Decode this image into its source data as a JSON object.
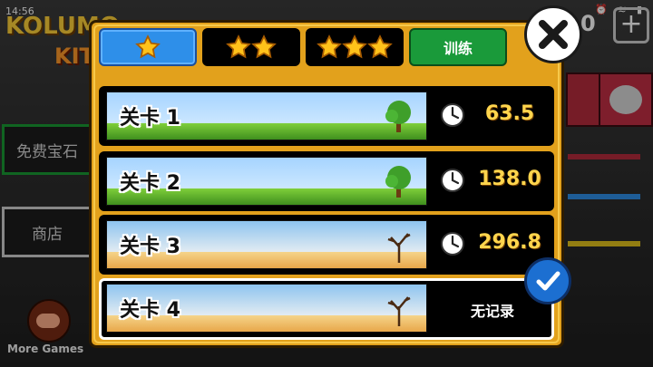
{
  "status_bar": {
    "time": "14:56",
    "icons": [
      "wifi-icon",
      "alarm-icon",
      "battery-icon"
    ]
  },
  "background": {
    "logo_line1": "KOLUMO",
    "logo_line2": "KITT",
    "left_buttons": [
      {
        "label": "免费宝石",
        "style": "green"
      },
      {
        "label": "商店",
        "style": "gray"
      }
    ],
    "more_games": "More Games",
    "counter": "0",
    "plus": "+"
  },
  "tabs": [
    {
      "type": "stars",
      "stars": 1,
      "active": true
    },
    {
      "type": "stars",
      "stars": 2,
      "active": false
    },
    {
      "type": "stars",
      "stars": 3,
      "active": false
    },
    {
      "type": "text",
      "label": "训练",
      "active": false
    }
  ],
  "levels": [
    {
      "title": "关卡 1",
      "time": "63.5",
      "theme": "grass",
      "selected": false
    },
    {
      "title": "关卡 2",
      "time": "138.0",
      "theme": "grass",
      "selected": false
    },
    {
      "title": "关卡 3",
      "time": "296.8",
      "theme": "desert",
      "selected": false
    },
    {
      "title": "关卡 4",
      "time": "",
      "no_record": "无记录",
      "theme": "desert",
      "selected": true
    }
  ],
  "colors": {
    "popup": "#e2a11c",
    "active_tab": "#2e8fe9",
    "train_tab": "#1a9a3a",
    "time_text": "#ffd54d",
    "confirm": "#1c6fd1"
  }
}
